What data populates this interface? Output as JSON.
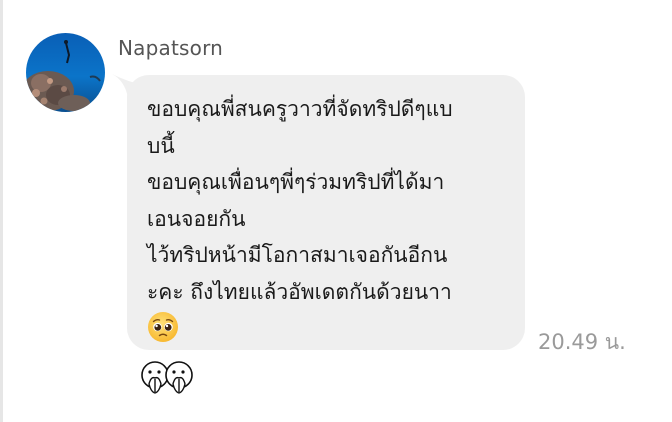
{
  "sender": {
    "name": "Napatsorn",
    "avatar_icon": "ocean-reef-avatar"
  },
  "message": {
    "lines": [
      "ขอบคุณพี่สนครูวาวที่จัดทริปดีๆแบ",
      "บนี้",
      "ขอบคุณเพื่อนๆพี่ๆร่วมทริปที่ได้มา",
      "เอนจอยกัน",
      "ไว้ทริปหน้ามีโอกาสมาเจอกันอีกน",
      "ะคะ ถึงไทยแล้วอัพเดตกันด้วยนาา"
    ],
    "emoji": "pleading-face-emoji",
    "timestamp": "20.49 น.",
    "bubble_color": "#efefef"
  },
  "reaction": {
    "icon": "hands-together-outline-emoji"
  }
}
